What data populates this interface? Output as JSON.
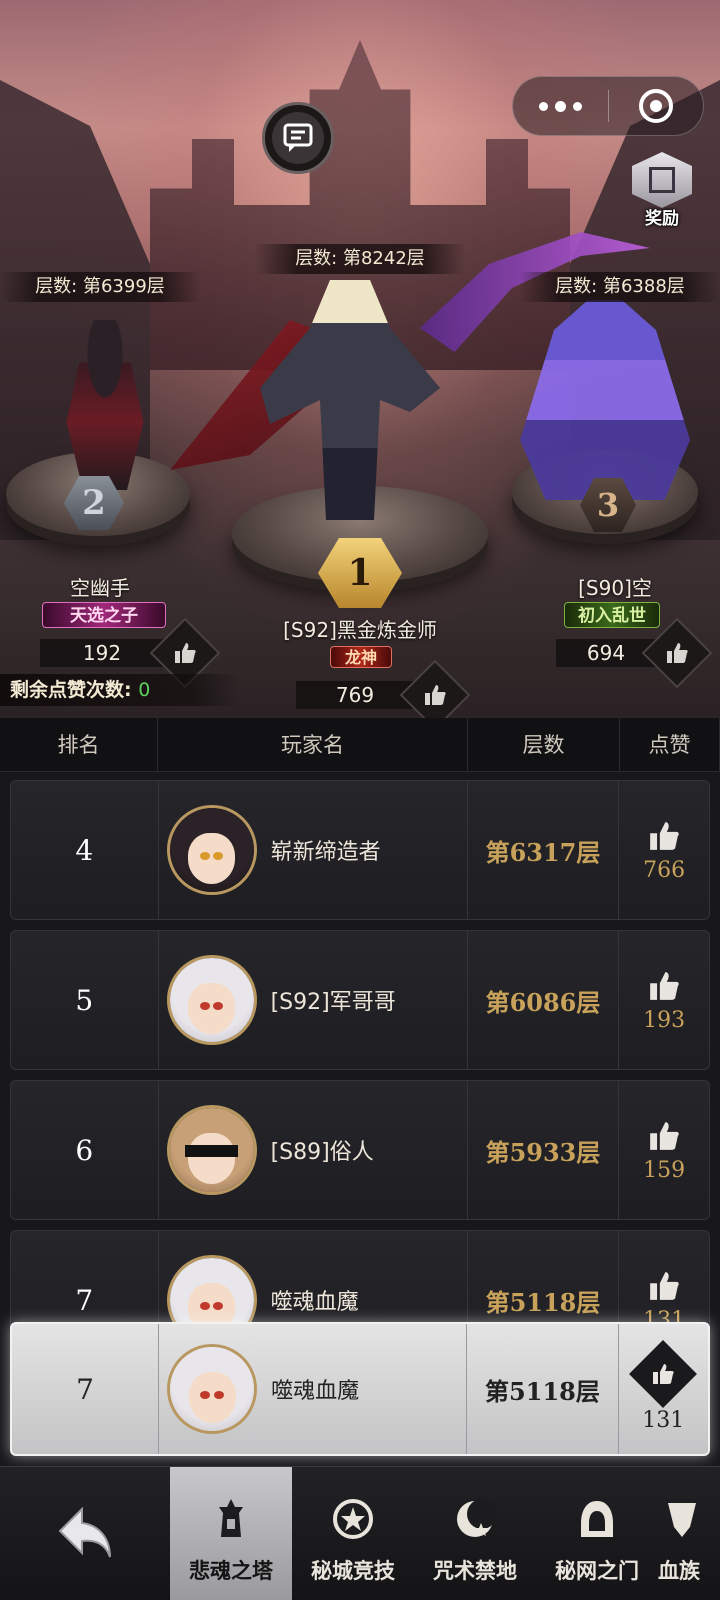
{
  "podium": {
    "first": {
      "floor_label": "层数: 第8242层",
      "rank": "1",
      "name": "[S92]黑金炼金师",
      "title_tag": "龙神",
      "likes": "769"
    },
    "second": {
      "floor_label": "层数: 第6399层",
      "rank": "2",
      "name": "空幽手",
      "title_tag": "天选之子",
      "likes": "192"
    },
    "third": {
      "floor_label": "层数: 第6388层",
      "rank": "3",
      "name": "[S90]空",
      "title_tag": "初入乱世",
      "likes": "694"
    }
  },
  "reward_label": "奖励",
  "remaining_likes": {
    "label": "剩余点赞次数:",
    "value": "0"
  },
  "table_header": {
    "rank": "排名",
    "player": "玩家名",
    "floor": "层数",
    "like": "点赞"
  },
  "rows": [
    {
      "rank": "4",
      "name": "崭新缔造者",
      "floor": "第6317层",
      "likes": "766"
    },
    {
      "rank": "5",
      "name": "[S92]军哥哥",
      "floor": "第6086层",
      "likes": "193"
    },
    {
      "rank": "6",
      "name": "[S89]俗人",
      "floor": "第5933层",
      "likes": "159"
    },
    {
      "rank": "7",
      "name": "噬魂血魔",
      "floor": "第5118层",
      "likes": "131"
    }
  ],
  "self_row": {
    "rank": "7",
    "name": "噬魂血魔",
    "floor": "第5118层",
    "likes": "131"
  },
  "nav": {
    "tabs": [
      {
        "label": "悲魂之塔",
        "icon": "tower-icon"
      },
      {
        "label": "秘城竞技",
        "icon": "arena-star-icon"
      },
      {
        "label": "咒术禁地",
        "icon": "crescent-moon-icon"
      },
      {
        "label": "秘网之门",
        "icon": "hooded-figure-icon"
      },
      {
        "label": "血族",
        "icon": "fang-icon"
      }
    ]
  },
  "colors": {
    "gold": "#c8a25a",
    "like_green": "#5ed05e",
    "active_tab": "#b4b4b8"
  }
}
